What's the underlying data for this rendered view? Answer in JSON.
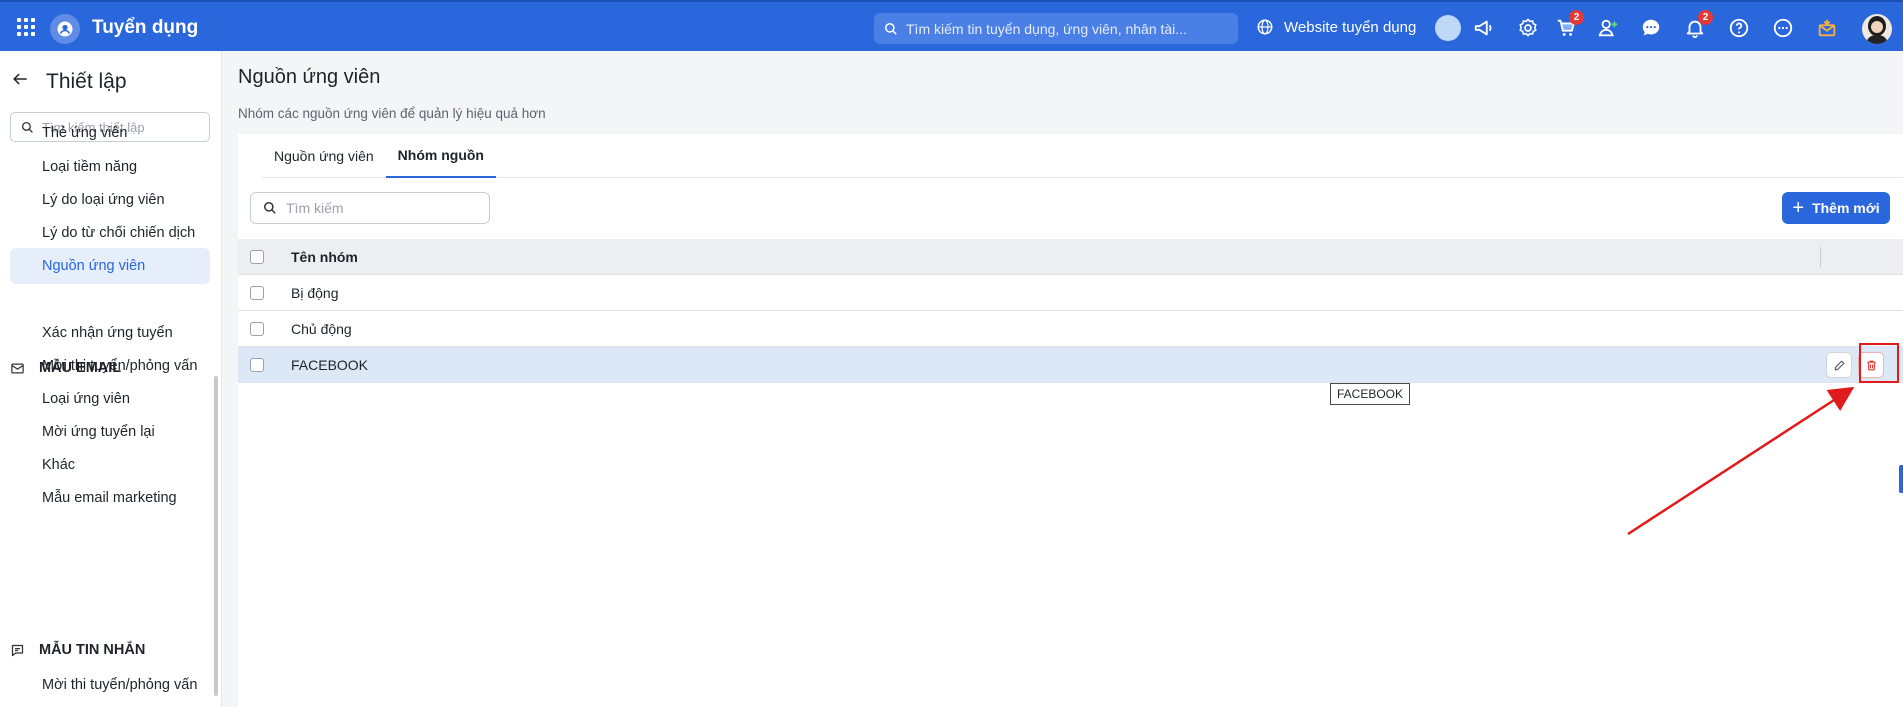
{
  "app": {
    "title": "Tuyển dụng",
    "search_placeholder": "Tìm kiếm tin tuyển dụng, ứng viên, nhân tài...",
    "website_label": "Website tuyển dụng",
    "cart_badge": "2",
    "notification_badge": "2"
  },
  "sidebar": {
    "title": "Thiết lập",
    "search_placeholder": "Tìm kiếm thiết lập",
    "items_top": [
      {
        "label": "Thẻ ứng viên"
      },
      {
        "label": "Loại tiềm năng"
      },
      {
        "label": "Lý do loại ứng viên"
      },
      {
        "label": "Lý do từ chối chiến dịch"
      },
      {
        "label": "Nguồn ứng viên"
      }
    ],
    "section_email": "MẪU EMAIL",
    "items_email": [
      {
        "label": "Xác nhận ứng tuyển"
      },
      {
        "label": "Mời thi tuyển/phỏng vấn"
      },
      {
        "label": "Loại ứng viên"
      },
      {
        "label": "Mời ứng tuyển lại"
      },
      {
        "label": "Khác"
      },
      {
        "label": "Mẫu email marketing"
      }
    ],
    "section_sms": "MẪU TIN NHẮN",
    "items_sms": [
      {
        "label": "Mời thi tuyển/phỏng vấn"
      }
    ]
  },
  "page": {
    "title": "Nguồn ứng viên",
    "description": "Nhóm các nguồn ứng viên để quản lý hiệu quả hơn",
    "tabs": [
      {
        "label": "Nguồn ứng viên"
      },
      {
        "label": "Nhóm nguồn"
      }
    ],
    "search_placeholder": "Tìm kiếm",
    "add_button": "Thêm mới"
  },
  "table": {
    "header": "Tên nhóm",
    "rows": [
      {
        "name": "Bị động"
      },
      {
        "name": "Chủ động"
      },
      {
        "name": "FACEBOOK"
      }
    ]
  },
  "tooltip": "FACEBOOK",
  "colors": {
    "primary": "#2a66dc",
    "highlight": "#e01b1b",
    "selected_row": "#dde8f7"
  }
}
